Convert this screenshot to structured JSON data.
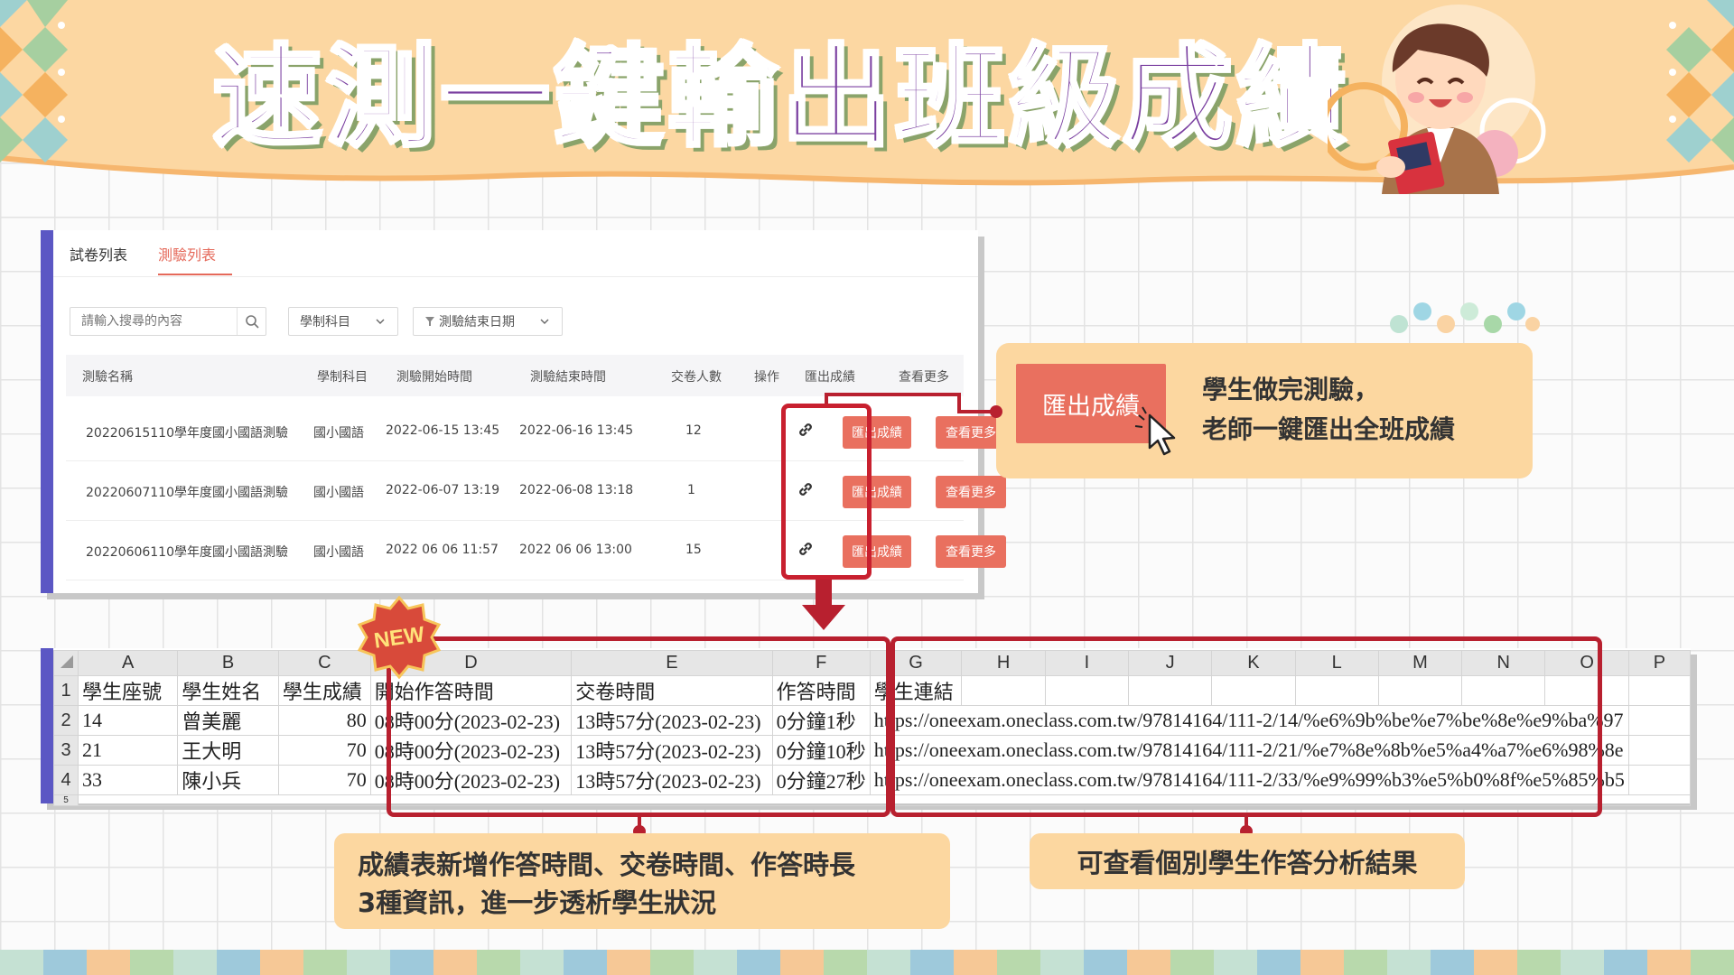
{
  "header": {
    "title": "速測一鍵輸出班級成績"
  },
  "app": {
    "tabs": [
      "試卷列表",
      "測驗列表"
    ],
    "search_placeholder": "請輸入搜尋的內容",
    "subject_filter": "學制科目",
    "date_filter": "測驗結束日期",
    "columns": [
      "測驗名稱",
      "學制科目",
      "測驗開始時間",
      "測驗結束時間",
      "交卷人數",
      "操作",
      "匯出成績",
      "查看更多"
    ],
    "rows": [
      {
        "name": "20220615110學年度國小國語測驗",
        "subject": "國小國語",
        "start": "2022-06-15 13:45",
        "end": "2022-06-16 13:45",
        "count": "12"
      },
      {
        "name": "20220607110學年度國小國語測驗",
        "subject": "國小國語",
        "start": "2022-06-07 13:19",
        "end": "2022-06-08 13:18",
        "count": "1"
      },
      {
        "name": "20220606110學年度國小國語測驗",
        "subject": "國小國語",
        "start": "2022 06 06 11:57",
        "end": "2022 06 06 13:00",
        "count": "15"
      }
    ],
    "export_label": "匯出成績",
    "more_label": "查看更多"
  },
  "callout_top": {
    "button_label": "匯出成績",
    "line1": "學生做完測驗，",
    "line2": "老師一鍵匯出全班成績"
  },
  "sheet": {
    "col_letters": [
      "A",
      "B",
      "C",
      "D",
      "E",
      "F",
      "G",
      "H",
      "I",
      "J",
      "K",
      "L",
      "M",
      "N",
      "O",
      "P"
    ],
    "headers": [
      "學生座號",
      "學生姓名",
      "學生成績",
      "開始作答時間",
      "交卷時間",
      "作答時間",
      "學生連結"
    ],
    "rows": [
      {
        "no": "14",
        "name": "曾美麗",
        "score": "80",
        "start": "08時00分(2023-02-23)",
        "submit": "13時57分(2023-02-23)",
        "duration": "0分鐘1秒",
        "link": "https://oneexam.oneclass.com.tw/97814164/111-2/14/%e6%9b%be%e7%be%8e%e9%ba%97"
      },
      {
        "no": "21",
        "name": "王大明",
        "score": "70",
        "start": "08時00分(2023-02-23)",
        "submit": "13時57分(2023-02-23)",
        "duration": "0分鐘10秒",
        "link": "https://oneexam.oneclass.com.tw/97814164/111-2/21/%e7%8e%8b%e5%a4%a7%e6%98%8e"
      },
      {
        "no": "33",
        "name": "陳小兵",
        "score": "70",
        "start": "08時00分(2023-02-23)",
        "submit": "13時57分(2023-02-23)",
        "duration": "0分鐘27秒",
        "link": "https://oneexam.oneclass.com.tw/97814164/111-2/33/%e9%99%b3%e5%b0%8f%e5%85%b5"
      }
    ],
    "row_numbers": [
      "1",
      "2",
      "3",
      "4",
      "5"
    ]
  },
  "badge": "NEW",
  "callout_bottom_left": {
    "line1": "成績表新增作答時間、交卷時間、作答時長",
    "line2": "3種資訊，進一步透析學生狀況"
  },
  "callout_bottom_right": "可查看個別學生作答分析結果",
  "colors": {
    "accent": "#e9705f",
    "highlight": "#c8202f",
    "panel_border": "#5b57c4",
    "callout_bg": "#fcd7a0",
    "title": "#7a3fa0"
  }
}
